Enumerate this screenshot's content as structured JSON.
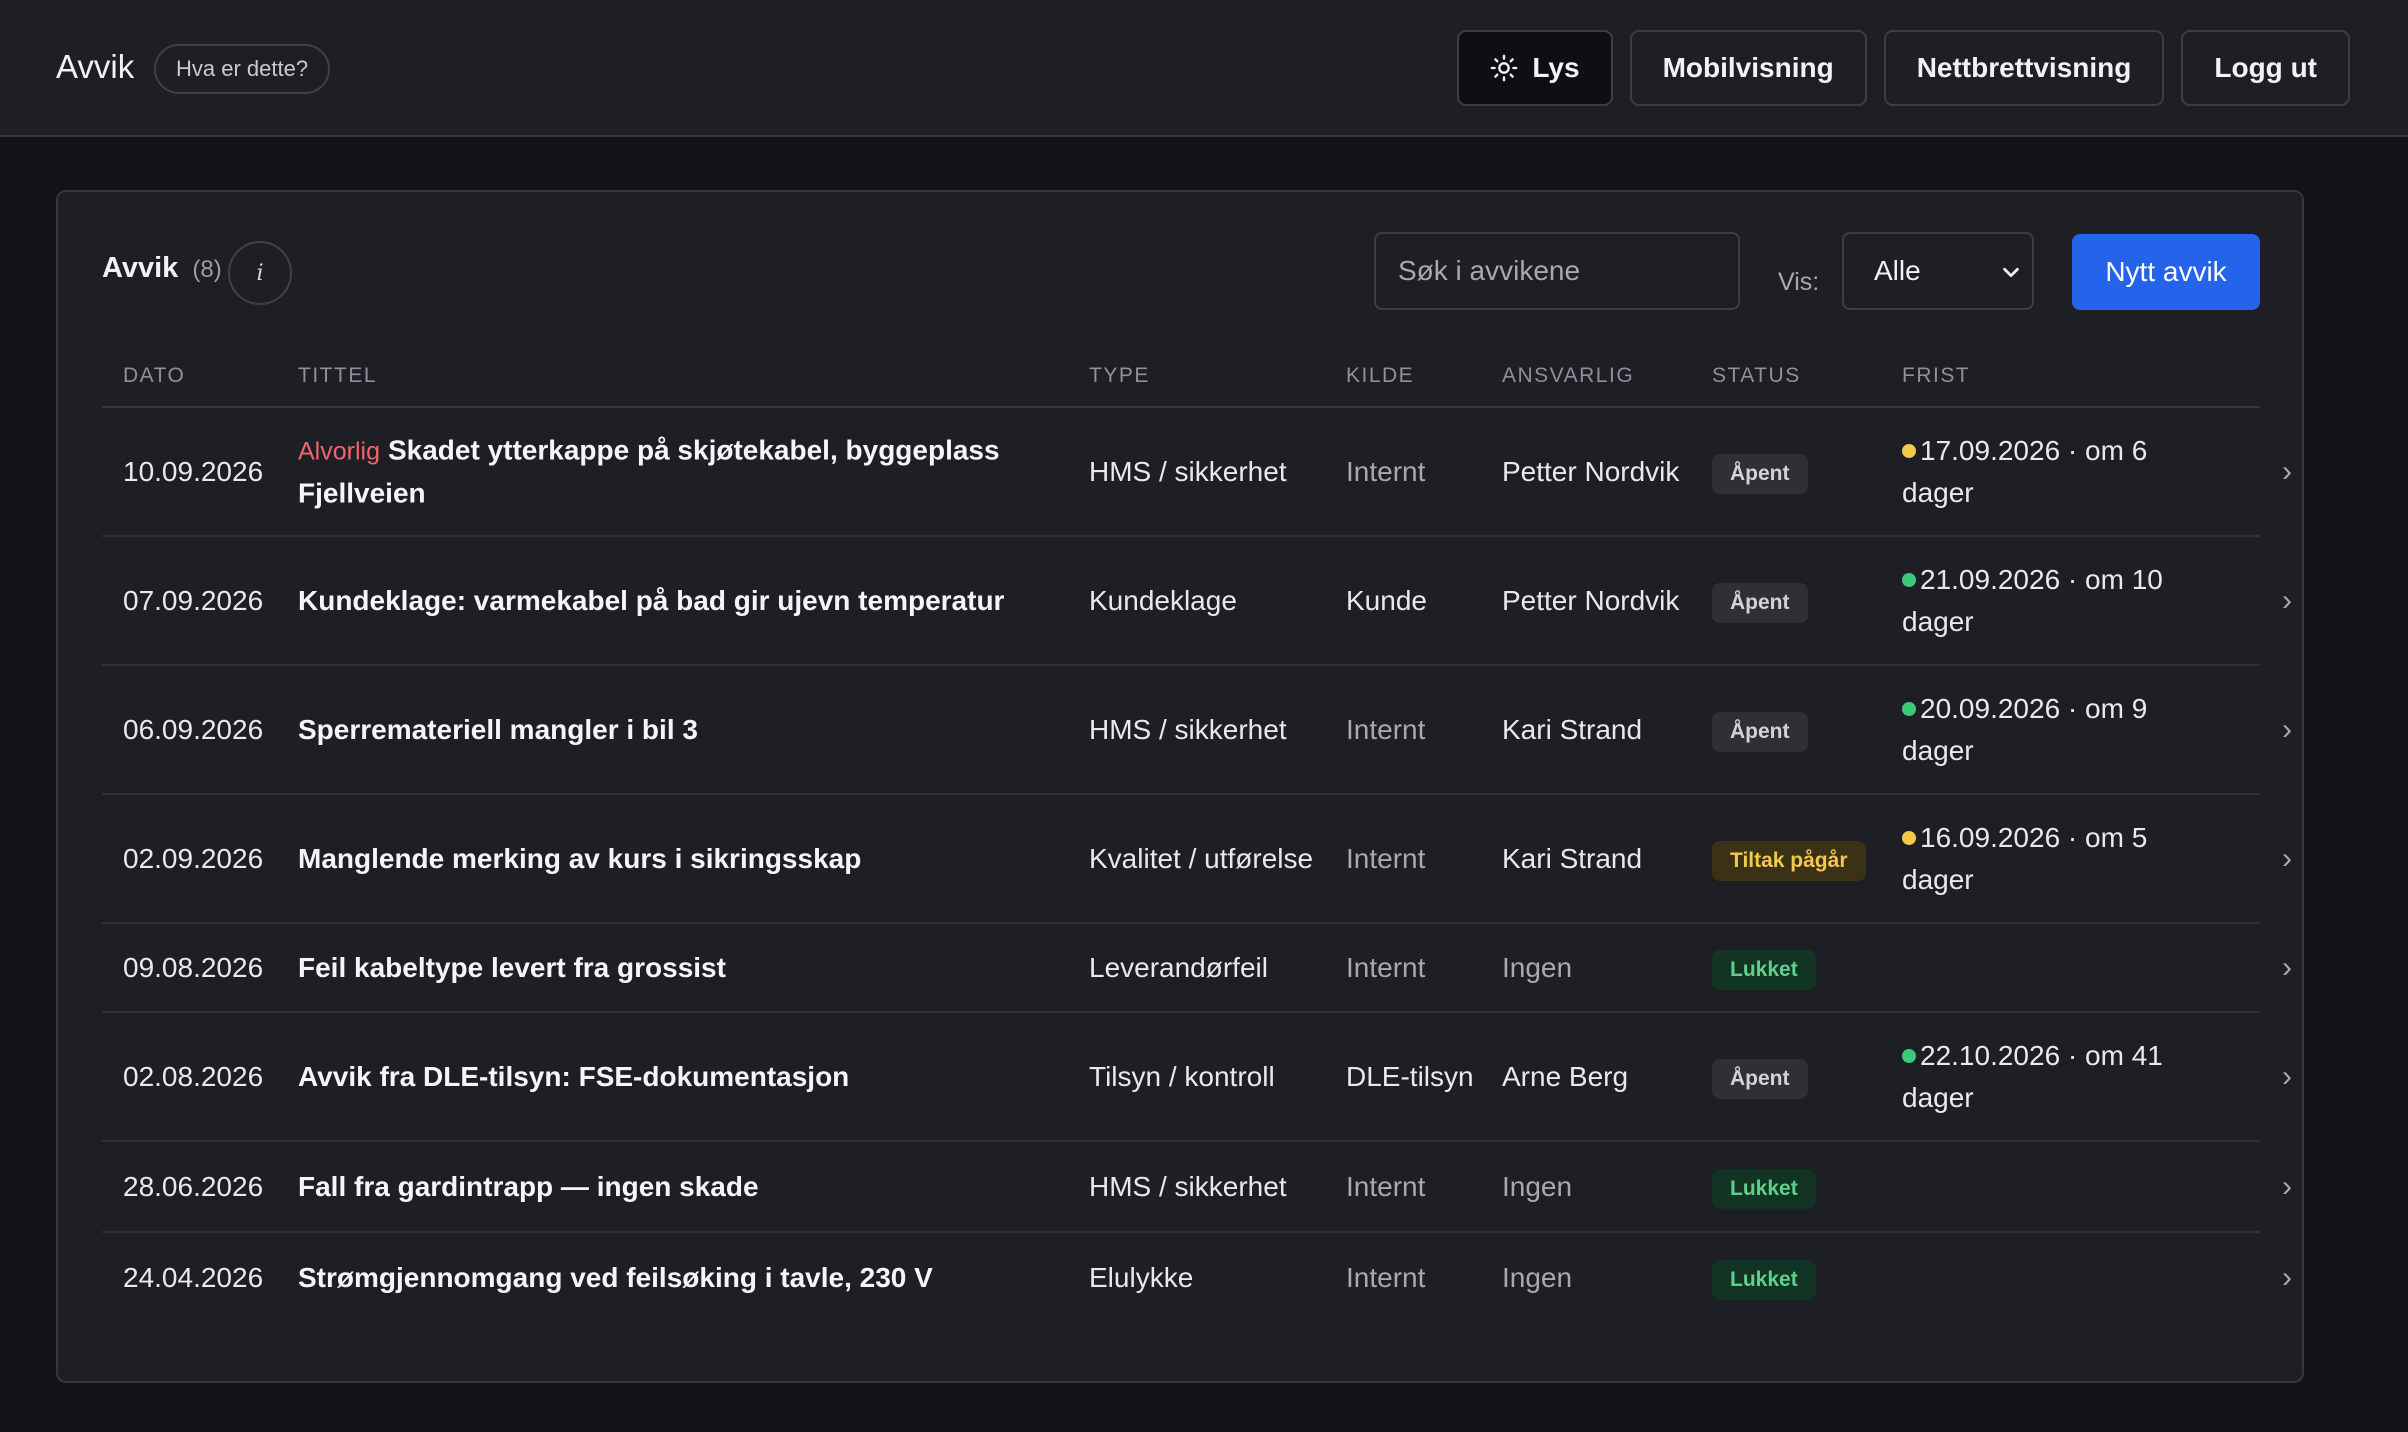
{
  "header": {
    "app_title": "Avvik",
    "help_label": "Hva er dette?",
    "theme_label": "Lys",
    "mobile_label": "Mobilvisning",
    "tablet_label": "Nettbrettvisning",
    "logout_label": "Logg ut"
  },
  "panel": {
    "title": "Avvik",
    "count": "(8)",
    "info_label": "i",
    "search_placeholder": "Søk i avvikene",
    "filter_label": "Vis:",
    "filter_value": "Alle",
    "new_button": "Nytt avvik"
  },
  "columns": {
    "date": "DATO",
    "title": "TITTEL",
    "type": "TYPE",
    "source": "KILDE",
    "responsible": "ANSVARLIG",
    "status": "STATUS",
    "deadline": "FRIST"
  },
  "colors": {
    "accent": "#2563eb",
    "deadline_warning": "#f2c94c",
    "deadline_ok": "#3ec97a",
    "severity": "#f2646b"
  },
  "rows": [
    {
      "date": "10.09.2026",
      "severity": "Alvorlig",
      "title": "Skadet ytterkappe på skjøtekabel, byggeplass Fjellveien",
      "type": "HMS / sikkerhet",
      "source": "Internt",
      "responsible": "Petter Nordvik",
      "status": "Åpent",
      "status_kind": "open",
      "deadline": "17.09.2026 · om 6 dager",
      "deadline_level": "warning"
    },
    {
      "date": "07.09.2026",
      "severity": "",
      "title": "Kundeklage: varmekabel på bad gir ujevn temperatur",
      "type": "Kundeklage",
      "source": "Kunde",
      "responsible": "Petter Nordvik",
      "status": "Åpent",
      "status_kind": "open",
      "deadline": "21.09.2026 · om 10 dager",
      "deadline_level": "ok"
    },
    {
      "date": "06.09.2026",
      "severity": "",
      "title": "Sperremateriell mangler i bil 3",
      "type": "HMS / sikkerhet",
      "source": "Internt",
      "responsible": "Kari Strand",
      "status": "Åpent",
      "status_kind": "open",
      "deadline": "20.09.2026 · om 9 dager",
      "deadline_level": "ok"
    },
    {
      "date": "02.09.2026",
      "severity": "",
      "title": "Manglende merking av kurs i sikringsskap",
      "type": "Kvalitet / utførelse",
      "source": "Internt",
      "responsible": "Kari Strand",
      "status": "Tiltak pågår",
      "status_kind": "progress",
      "deadline": "16.09.2026 · om 5 dager",
      "deadline_level": "warning"
    },
    {
      "date": "09.08.2026",
      "severity": "",
      "title": "Feil kabeltype levert fra grossist",
      "type": "Leverandørfeil",
      "source": "Internt",
      "responsible": "Ingen",
      "status": "Lukket",
      "status_kind": "closed",
      "deadline": "",
      "deadline_level": ""
    },
    {
      "date": "02.08.2026",
      "severity": "",
      "title": "Avvik fra DLE-tilsyn: FSE-dokumentasjon",
      "type": "Tilsyn / kontroll",
      "source": "DLE-tilsyn",
      "responsible": "Arne Berg",
      "status": "Åpent",
      "status_kind": "open",
      "deadline": "22.10.2026 · om 41 dager",
      "deadline_level": "ok"
    },
    {
      "date": "28.06.2026",
      "severity": "",
      "title": "Fall fra gardintrapp — ingen skade",
      "type": "HMS / sikkerhet",
      "source": "Internt",
      "responsible": "Ingen",
      "status": "Lukket",
      "status_kind": "closed",
      "deadline": "",
      "deadline_level": ""
    },
    {
      "date": "24.04.2026",
      "severity": "",
      "title": "Strømgjennomgang ved feilsøking i tavle, 230 V",
      "type": "Elulykke",
      "source": "Internt",
      "responsible": "Ingen",
      "status": "Lukket",
      "status_kind": "closed",
      "deadline": "",
      "deadline_level": ""
    }
  ]
}
